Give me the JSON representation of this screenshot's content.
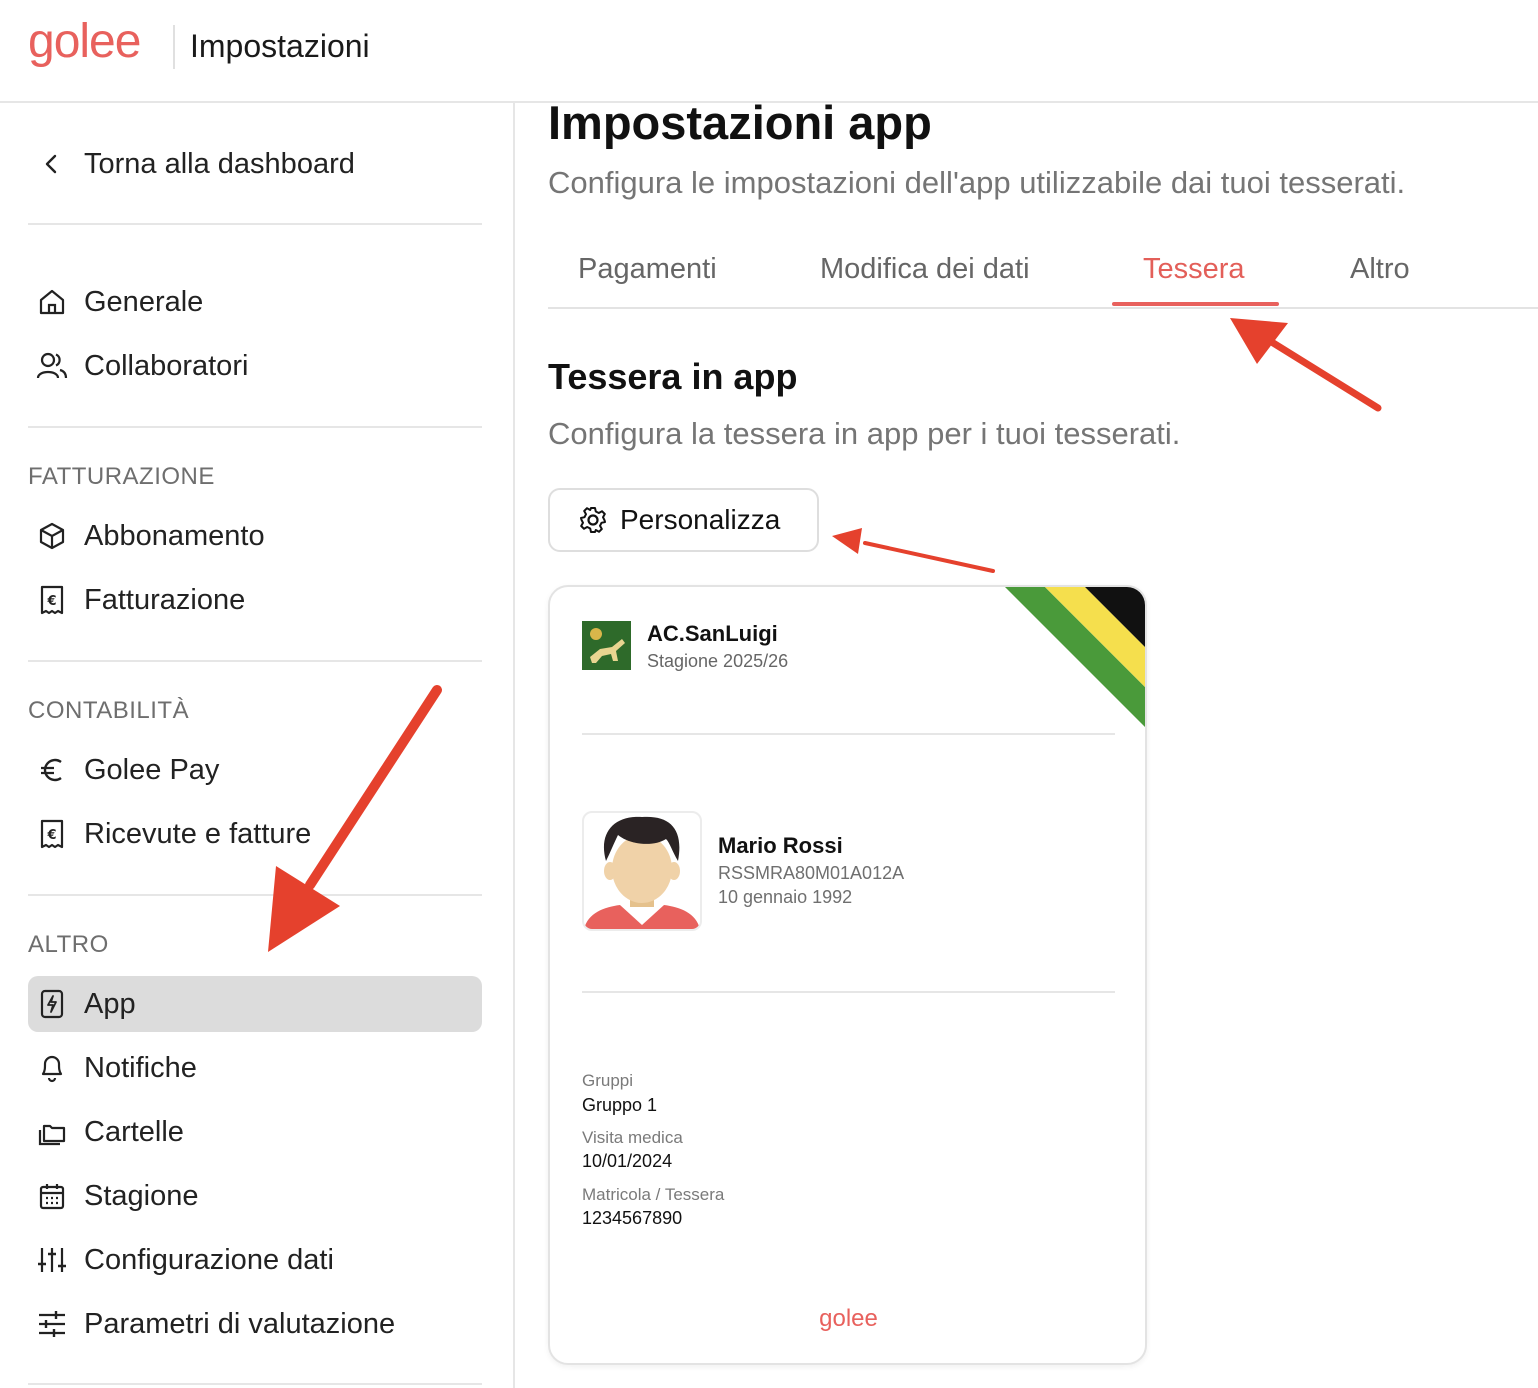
{
  "header": {
    "logo": "golee",
    "title": "Impostazioni"
  },
  "sidebar": {
    "back_label": "Torna alla dashboard",
    "main_items": [
      {
        "label": "Generale",
        "icon": "home-icon"
      },
      {
        "label": "Collaboratori",
        "icon": "users-icon"
      }
    ],
    "sections": [
      {
        "title": "FATTURAZIONE",
        "items": [
          {
            "label": "Abbonamento",
            "icon": "box-icon"
          },
          {
            "label": "Fatturazione",
            "icon": "receipt-icon"
          }
        ]
      },
      {
        "title": "CONTABILITÀ",
        "items": [
          {
            "label": "Golee Pay",
            "icon": "euro-icon"
          },
          {
            "label": "Ricevute e fatture",
            "icon": "receipt-icon"
          }
        ]
      },
      {
        "title": "ALTRO",
        "items": [
          {
            "label": "App",
            "icon": "app-icon",
            "active": true
          },
          {
            "label": "Notifiche",
            "icon": "bell-icon"
          },
          {
            "label": "Cartelle",
            "icon": "folders-icon"
          },
          {
            "label": "Stagione",
            "icon": "calendar-icon"
          },
          {
            "label": "Configurazione dati",
            "icon": "sliders-vertical-icon"
          },
          {
            "label": "Parametri di valutazione",
            "icon": "sliders-horizontal-icon"
          }
        ]
      }
    ]
  },
  "main": {
    "title": "Impostazioni app",
    "subtitle": "Configura le impostazioni dell'app utilizzabile dai tuoi tesserati.",
    "tabs": [
      {
        "label": "Pagamenti"
      },
      {
        "label": "Modifica dei dati"
      },
      {
        "label": "Tessera",
        "active": true
      },
      {
        "label": "Altro"
      }
    ],
    "section_title": "Tessera in app",
    "section_subtitle": "Configura la tessera in app per i tuoi tesserati.",
    "customize_button": "Personalizza"
  },
  "card": {
    "club_name": "AC.SanLuigi",
    "season": "Stagione 2025/26",
    "member_name": "Mario Rossi",
    "tax_code": "RSSMRA80M01A012A",
    "birth_date": "10 gennaio 1992",
    "fields": [
      {
        "label": "Gruppi",
        "value": "Gruppo 1"
      },
      {
        "label": "Visita medica",
        "value": "10/01/2024"
      },
      {
        "label": "Matricola / Tessera",
        "value": "1234567890"
      }
    ],
    "brand": "golee",
    "stripe_colors": [
      "#4a9a3a",
      "#f5df4d",
      "#111111"
    ]
  },
  "colors": {
    "accent": "#e8615d",
    "active_bg": "#dcdcdc",
    "arrow": "#e5412d"
  }
}
